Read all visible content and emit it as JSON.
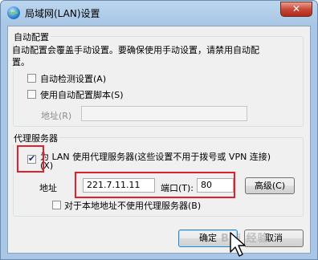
{
  "window": {
    "title": "局域网(LAN)设置",
    "close_glyph": "✕"
  },
  "auto_config": {
    "legend": "自动配置",
    "description_line1": "自动配置会覆盖手动设置。要确保使用手动设置，请禁用自动配",
    "description_line2": "置。",
    "auto_detect": {
      "label": "自动检测设置(A)",
      "checked": false
    },
    "use_script": {
      "label": "使用自动配置脚本(S)",
      "checked": false
    },
    "address_label": "地址(R)",
    "address_value": ""
  },
  "proxy": {
    "legend": "代理服务器",
    "use_proxy": {
      "label_line1": "为 LAN 使用代理服务器(这些设置不用于拨号或 VPN 连接)",
      "label_line2": "(X)",
      "checked": true
    },
    "address_label": "地址",
    "address_value": "221.7.11.11",
    "port_label": "端口(T):",
    "port_value": "80",
    "advanced_label": "高级(C)",
    "bypass_local": {
      "label": "对于本地地址不使用代理服务器(B)",
      "checked": false
    }
  },
  "buttons": {
    "ok": "确定",
    "cancel": "取消"
  },
  "watermark": "Bai 经验",
  "icons": {
    "app": "network-globe-icon",
    "close": "close-icon",
    "cursor": "mouse-cursor-icon"
  },
  "colors": {
    "highlight": "#e0202c",
    "titlebar": "#a9c6e6"
  }
}
